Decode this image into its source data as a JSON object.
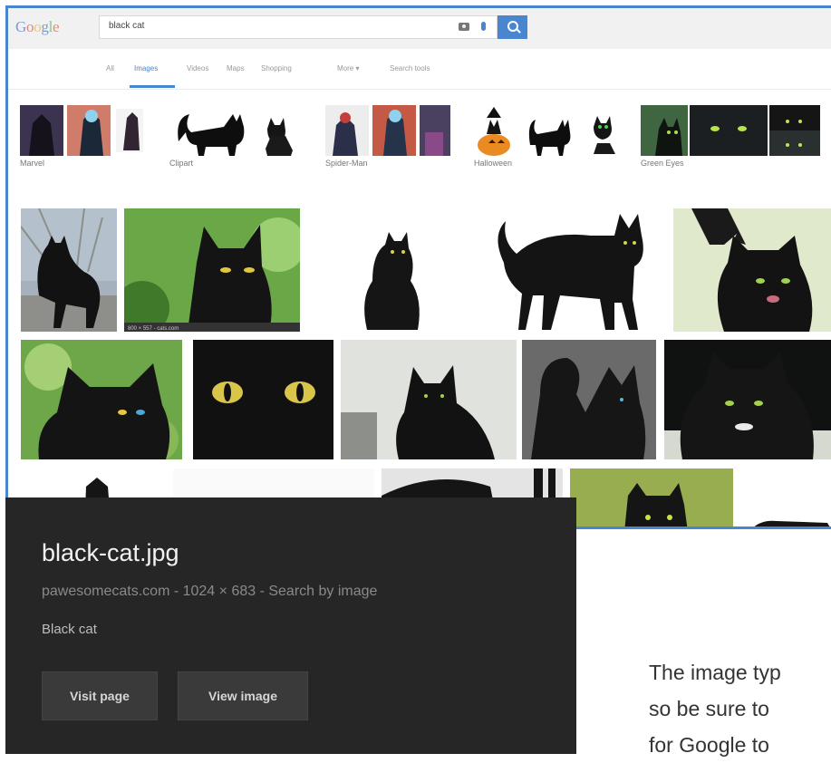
{
  "browser": {
    "logo": "Google",
    "search_query": "black cat"
  },
  "tabs": [
    "All",
    "Images",
    "Videos",
    "Maps",
    "Shopping",
    "More ▾",
    "Search tools"
  ],
  "categories": [
    "Marvel",
    "Clipart",
    "Spider-Man",
    "Halloween",
    "Green Eyes"
  ],
  "tooltip": {
    "filename": "black-cat.jpg",
    "meta": "pawesomecats.com - 1024 × 683 - Search by image",
    "description": "Black cat",
    "visit_label": "Visit page",
    "view_label": "View image"
  },
  "overlay_caption": "800 × 557 - cats.com",
  "body_text": {
    "line1": "The image typ",
    "line2": "so be sure to",
    "line3": "for Google to"
  },
  "colors": {
    "accent": "#4a86cf",
    "tooltip_bg": "#262626"
  },
  "icons": [
    "camera-icon",
    "microphone-icon",
    "search-icon"
  ]
}
